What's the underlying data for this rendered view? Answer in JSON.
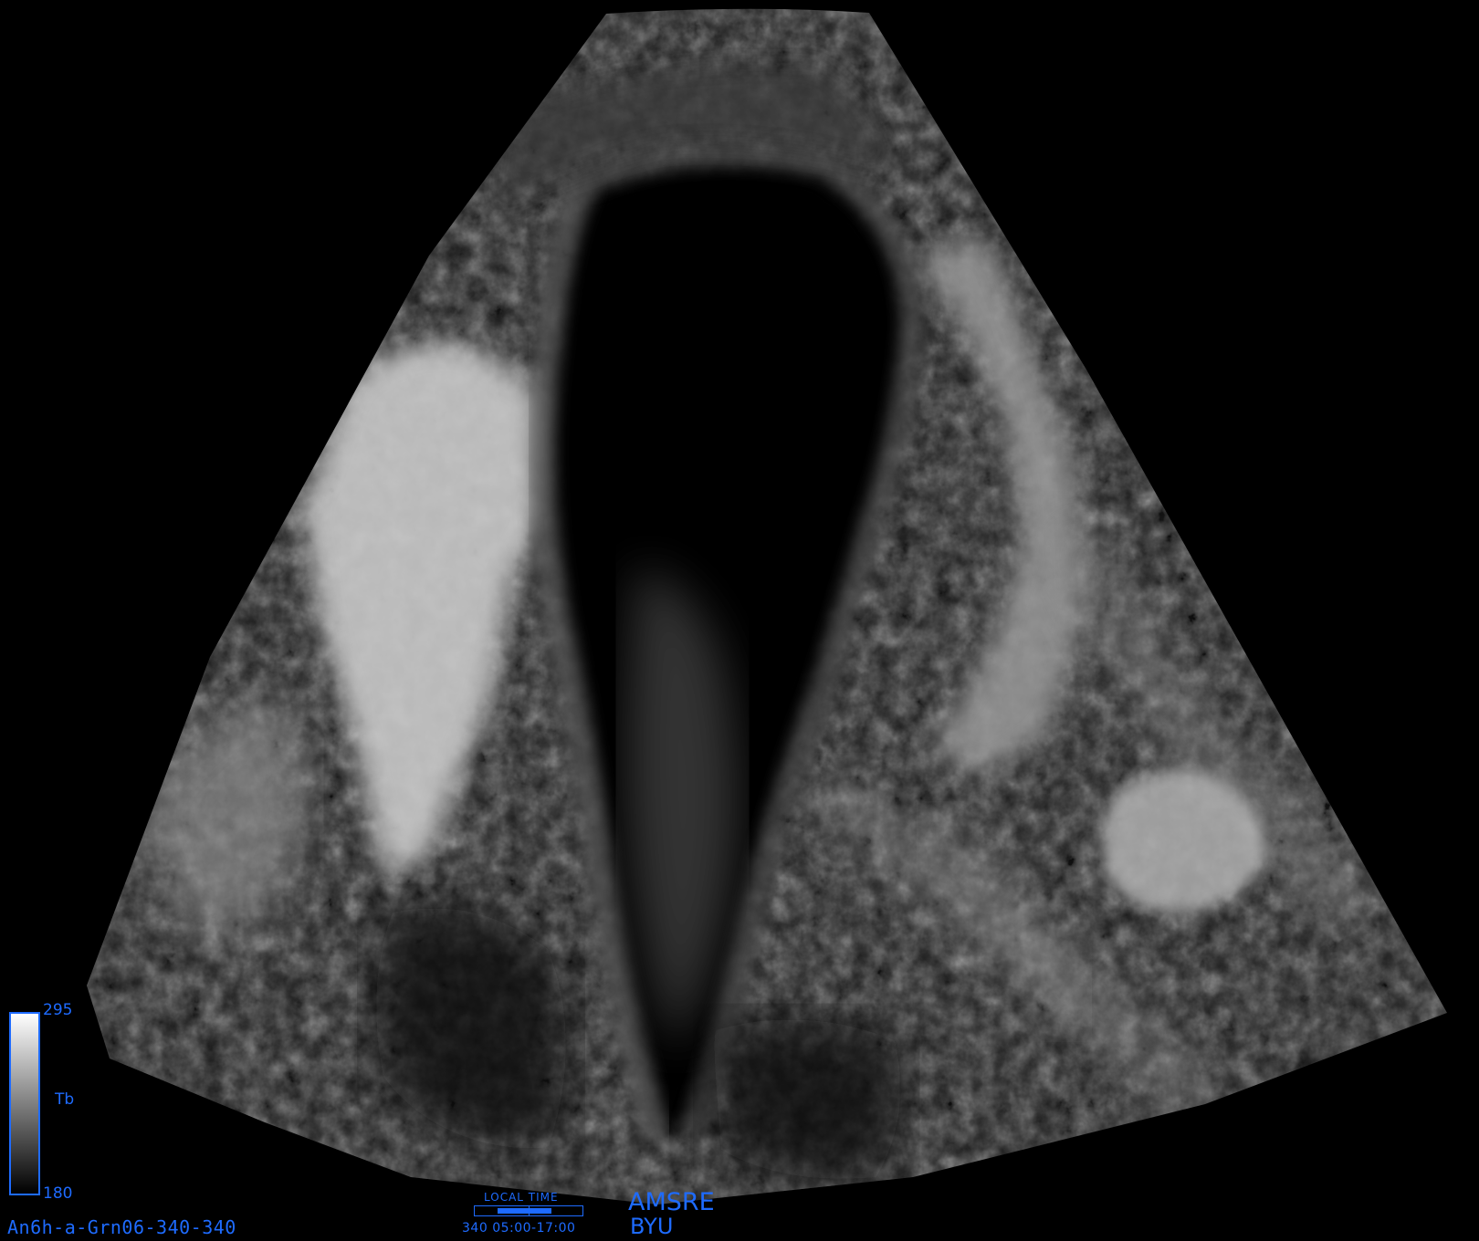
{
  "map": {
    "title": "An6h-a-Grn06-340-340",
    "sensor": "AMSRE",
    "institution": "BYU",
    "colorbar": {
      "max": "295",
      "min": "180",
      "variable": "Tb",
      "scale": "grayscale",
      "accent": "#1e6bff"
    },
    "local_time": {
      "title": "LOCAL TIME",
      "day": "340",
      "range": "05:00-17:00",
      "fill_start_fraction": 0.208,
      "fill_end_fraction": 0.708
    }
  }
}
